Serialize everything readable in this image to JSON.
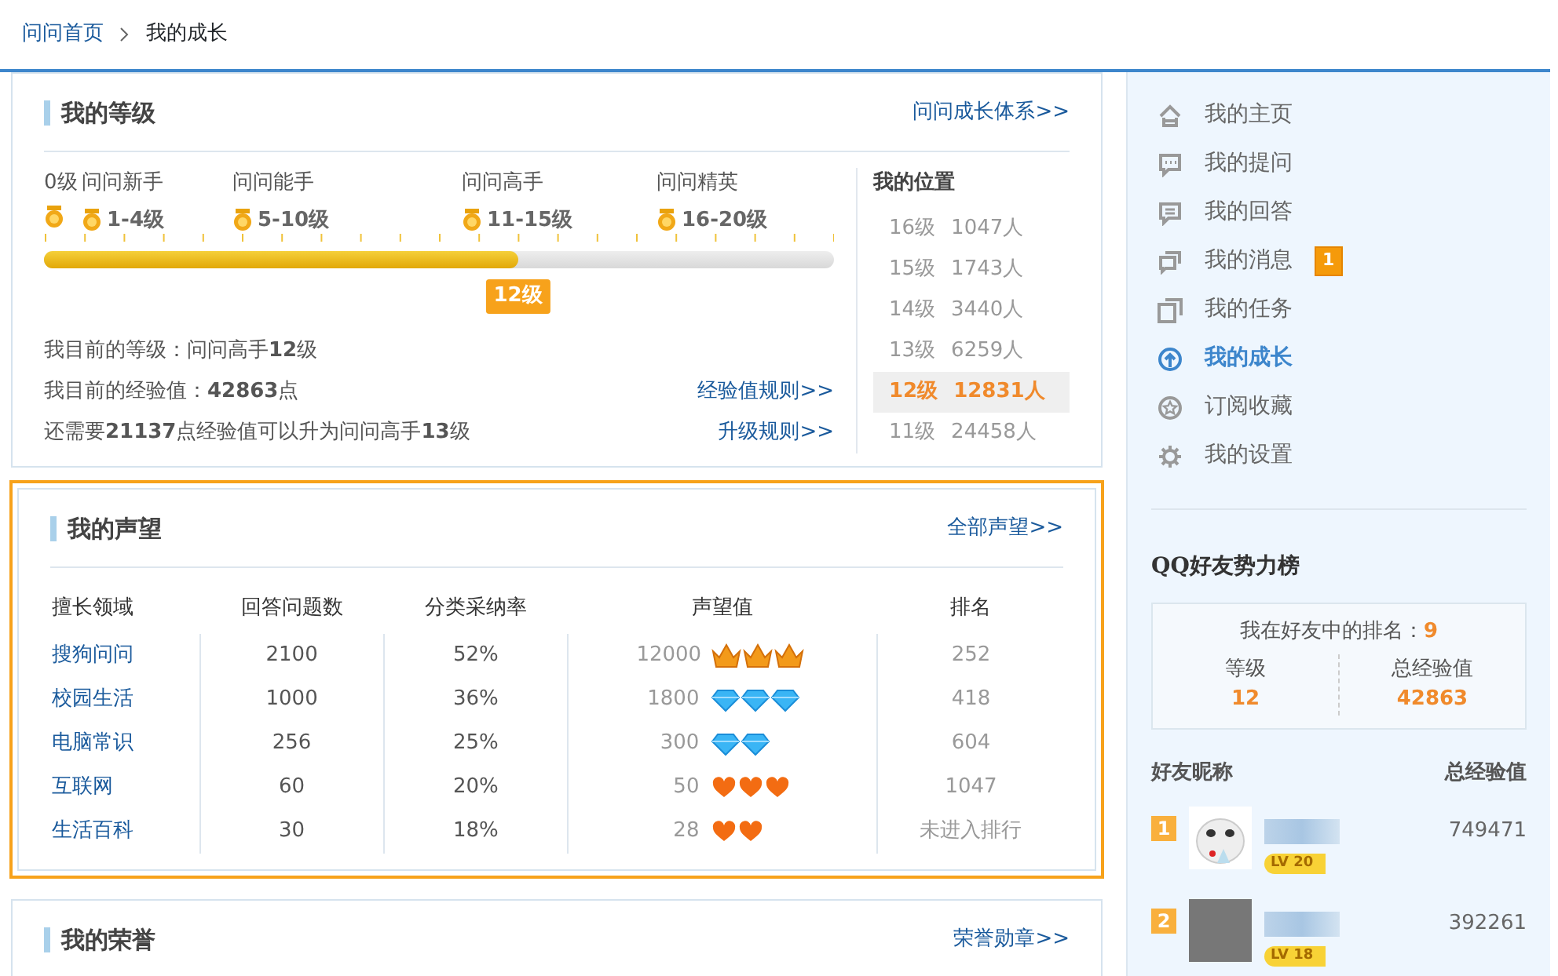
{
  "breadcrumb": [
    {
      "label": "问问首页",
      "kind": "link"
    },
    {
      "label": "我的成长",
      "kind": "current"
    }
  ],
  "level_panel": {
    "title": "我的等级",
    "link": "问问成长体系>>",
    "start_label": "0级",
    "milestones": [
      {
        "title": "问问新手",
        "range": "1-4级"
      },
      {
        "title": "问问能手",
        "range": "5-10级"
      },
      {
        "title": "问问高手",
        "range": "11-15级"
      },
      {
        "title": "问问精英",
        "range": "16-20级"
      }
    ],
    "level": 0.6,
    "current_tag": "12级",
    "info": [
      {
        "text": "我目前的等级：问问高手**12**级"
      },
      {
        "text": "我目前的经验值：**42863**点",
        "link": "经验值规则>>"
      },
      {
        "text": "还需要**21137**点经验值可以升为问问高手**13**级",
        "link": "升级规则>>"
      }
    ],
    "position": {
      "title": "我的位置",
      "rows": [
        {
          "grade": "16级",
          "count": "1047人",
          "selected": false
        },
        {
          "grade": "15级",
          "count": "1743人",
          "selected": false
        },
        {
          "grade": "14级",
          "count": "3440人",
          "selected": false
        },
        {
          "grade": "13级",
          "count": "6259人",
          "selected": false
        },
        {
          "grade": "12级",
          "count": "12831人",
          "selected": true
        },
        {
          "grade": "11级",
          "count": "24458人",
          "selected": false
        }
      ]
    }
  },
  "reputation_panel": {
    "title": "我的声望",
    "link": "全部声望>>",
    "highlighted": true,
    "columns": [
      "擅长领域",
      "回答问题数",
      "分类采纳率",
      "声望值",
      "排名"
    ],
    "rows": [
      {
        "field": "搜狗问问",
        "answers": "2100",
        "rate": "52%",
        "value": "12000",
        "badges": [
          {
            "kind": "crown"
          },
          {
            "kind": "crown"
          },
          {
            "kind": "crown"
          }
        ],
        "rank": "252"
      },
      {
        "field": "校园生活",
        "answers": "1000",
        "rate": "36%",
        "value": "1800",
        "badges": [
          {
            "kind": "diamond"
          },
          {
            "kind": "diamond"
          },
          {
            "kind": "diamond"
          }
        ],
        "rank": "418"
      },
      {
        "field": "电脑常识",
        "answers": "256",
        "rate": "25%",
        "value": "300",
        "badges": [
          {
            "kind": "diamond"
          },
          {
            "kind": "diamond"
          }
        ],
        "rank": "604"
      },
      {
        "field": "互联网",
        "answers": "60",
        "rate": "20%",
        "value": "50",
        "badges": [
          {
            "kind": "heart"
          },
          {
            "kind": "heart"
          },
          {
            "kind": "heart"
          }
        ],
        "rank": "1047"
      },
      {
        "field": "生活百科",
        "answers": "30",
        "rate": "18%",
        "value": "28",
        "badges": [
          {
            "kind": "heart"
          },
          {
            "kind": "heart"
          }
        ],
        "rank": "未进入排行"
      }
    ]
  },
  "honor_panel": {
    "title": "我的荣誉",
    "link": "荣誉勋章>>",
    "highlighted": false
  },
  "sidebar": {
    "nav": [
      {
        "label": "我的主页",
        "kind": "home",
        "selected": false
      },
      {
        "label": "我的提问",
        "kind": "question",
        "selected": false
      },
      {
        "label": "我的回答",
        "kind": "answer",
        "selected": false
      },
      {
        "label": "我的消息",
        "kind": "message",
        "selected": false,
        "badge": "1"
      },
      {
        "label": "我的任务",
        "kind": "task",
        "selected": false
      },
      {
        "label": "我的成长",
        "kind": "growth",
        "selected": true
      },
      {
        "label": "订阅收藏",
        "kind": "favorite",
        "selected": false
      },
      {
        "label": "我的设置",
        "kind": "settings",
        "selected": false
      }
    ],
    "friends_board": {
      "title": "QQ好友势力榜",
      "rank_label": "我在好友中的排名：",
      "rank_value": "9",
      "stats": [
        {
          "label": "等级",
          "value": "12"
        },
        {
          "label": "总经验值",
          "value": "42863"
        }
      ],
      "columns": [
        "好友昵称",
        "总经验值"
      ],
      "friends": [
        {
          "rank": "1",
          "kind": "cartoon",
          "level_badge": "LV 20",
          "score": "749471"
        },
        {
          "rank": "2",
          "kind": "photo",
          "level_badge": "LV 18",
          "score": "392261"
        }
      ]
    }
  }
}
